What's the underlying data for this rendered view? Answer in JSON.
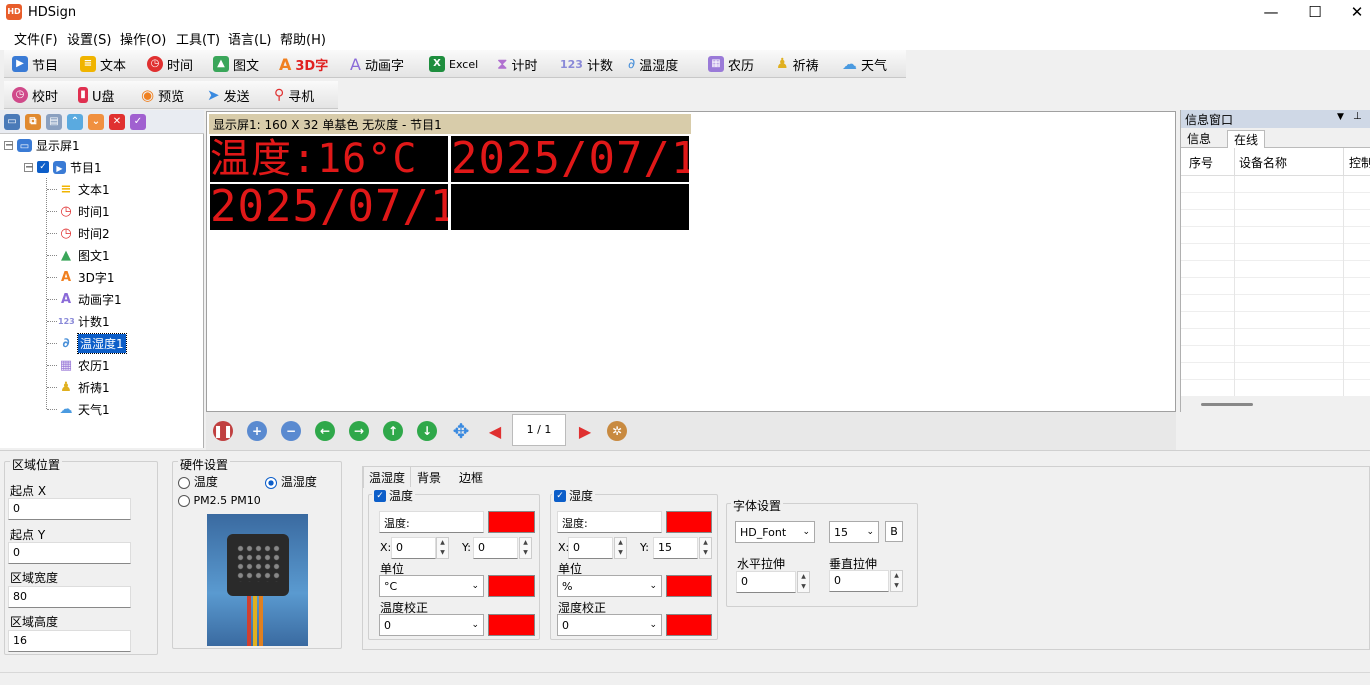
{
  "app": {
    "title": "HDSign",
    "icon_text": "HD"
  },
  "window_controls": {
    "minimize": "—",
    "maximize": "☐",
    "close": "✕"
  },
  "menu": [
    "文件(F)",
    "设置(S)",
    "操作(O)",
    "工具(T)",
    "语言(L)",
    "帮助(H)"
  ],
  "toolbar1": [
    {
      "label": "节目",
      "icon": "program-icon",
      "color": "#3a7bd5"
    },
    {
      "label": "文本",
      "icon": "text-icon",
      "color": "#f0b400"
    },
    {
      "label": "时间",
      "icon": "clock-icon",
      "color": "#e03030"
    },
    {
      "label": "图文",
      "icon": "picture-icon",
      "color": "#3aa65a"
    },
    {
      "label": "3D字",
      "icon": "3d-text-icon",
      "color": "#f08020"
    },
    {
      "label": "动画字",
      "icon": "animated-text-icon",
      "color": "#8a6ad8"
    },
    {
      "label": "Excel",
      "icon": "excel-icon",
      "color": "#1e8e3e"
    },
    {
      "label": "计时",
      "icon": "hourglass-icon",
      "color": "#b070d0"
    },
    {
      "label": "计数",
      "icon": "counter-icon",
      "color": "#8a8ad8"
    },
    {
      "label": "温湿度",
      "icon": "thermometer-icon",
      "color": "#4a90d9"
    },
    {
      "label": "农历",
      "icon": "lunar-calendar-icon",
      "color": "#9a7ad8"
    },
    {
      "label": "祈祷",
      "icon": "prayer-icon",
      "color": "#e0b020"
    },
    {
      "label": "天气",
      "icon": "weather-icon",
      "color": "#4a9ae0"
    }
  ],
  "toolbar2": [
    {
      "label": "校时",
      "icon": "time-sync-icon",
      "color": "#d04a8a"
    },
    {
      "label": "U盘",
      "icon": "usb-icon",
      "color": "#e03050"
    },
    {
      "label": "预览",
      "icon": "preview-icon",
      "color": "#f08020"
    },
    {
      "label": "发送",
      "icon": "send-icon",
      "color": "#3a8ae0"
    },
    {
      "label": "寻机",
      "icon": "search-device-icon",
      "color": "#e03030"
    }
  ],
  "tree": {
    "screen": "显示屏1",
    "program": "节目1",
    "items": [
      {
        "label": "文本1",
        "icon": "text-icon",
        "color": "#f0b400"
      },
      {
        "label": "时间1",
        "icon": "clock-icon",
        "color": "#e03030"
      },
      {
        "label": "时间2",
        "icon": "clock-icon",
        "color": "#e03030"
      },
      {
        "label": "图文1",
        "icon": "picture-icon",
        "color": "#3aa65a"
      },
      {
        "label": "3D字1",
        "icon": "3d-text-icon",
        "color": "#f08020"
      },
      {
        "label": "动画字1",
        "icon": "animated-text-icon",
        "color": "#8a6ad8"
      },
      {
        "label": "计数1",
        "icon": "counter-icon",
        "color": "#8a8ad8"
      },
      {
        "label": "温湿度1",
        "icon": "thermometer-icon",
        "color": "#4a90d9",
        "selected": true
      },
      {
        "label": "农历1",
        "icon": "lunar-calendar-icon",
        "color": "#9a7ad8"
      },
      {
        "label": "祈祷1",
        "icon": "prayer-icon",
        "color": "#e0b020"
      },
      {
        "label": "天气1",
        "icon": "weather-icon",
        "color": "#4a9ae0"
      }
    ]
  },
  "preview": {
    "header": "显示屏1: 160 X 32  单基色 无灰度 - 节目1",
    "cells": [
      "温度:16°C",
      "2025/07/1",
      "2025/07/1",
      ""
    ]
  },
  "navbar": {
    "page": "1 / 1"
  },
  "info_window": {
    "title": "信息窗口",
    "tabs": [
      "信息",
      "在线"
    ],
    "columns": [
      "序号",
      "设备名称",
      "控制"
    ]
  },
  "region": {
    "title": "区域位置",
    "start_x_label": "起点 X",
    "start_x": "0",
    "start_y_label": "起点 Y",
    "start_y": "0",
    "width_label": "区域宽度",
    "width": "80",
    "height_label": "区域高度",
    "height": "16"
  },
  "hardware": {
    "title": "硬件设置",
    "opt_temp": "温度",
    "opt_temp_hum": "温湿度",
    "opt_pm": "PM2.5 PM10"
  },
  "tabs": [
    "温湿度",
    "背景",
    "边框"
  ],
  "temperature": {
    "check_label": "温度",
    "prefix": "温度:",
    "x_label": "X:",
    "x": "0",
    "y_label": "Y:",
    "y": "0",
    "unit_label": "单位",
    "unit": "°C",
    "calib_label": "温度校正",
    "calib": "0"
  },
  "humidity": {
    "check_label": "湿度",
    "prefix": "湿度:",
    "x_label": "X:",
    "x": "0",
    "y_label": "Y:",
    "y": "15",
    "unit_label": "单位",
    "unit": "%",
    "calib_label": "湿度校正",
    "calib": "0"
  },
  "font": {
    "title": "字体设置",
    "name": "HD_Font",
    "size": "15",
    "bold": "B",
    "h_stretch_label": "水平拉伸",
    "h_stretch": "0",
    "v_stretch_label": "垂直拉伸",
    "v_stretch": "0"
  },
  "colors": {
    "led_red": "#e01818",
    "swatch_red": "#ff0000",
    "accent": "#0c5ec9"
  }
}
